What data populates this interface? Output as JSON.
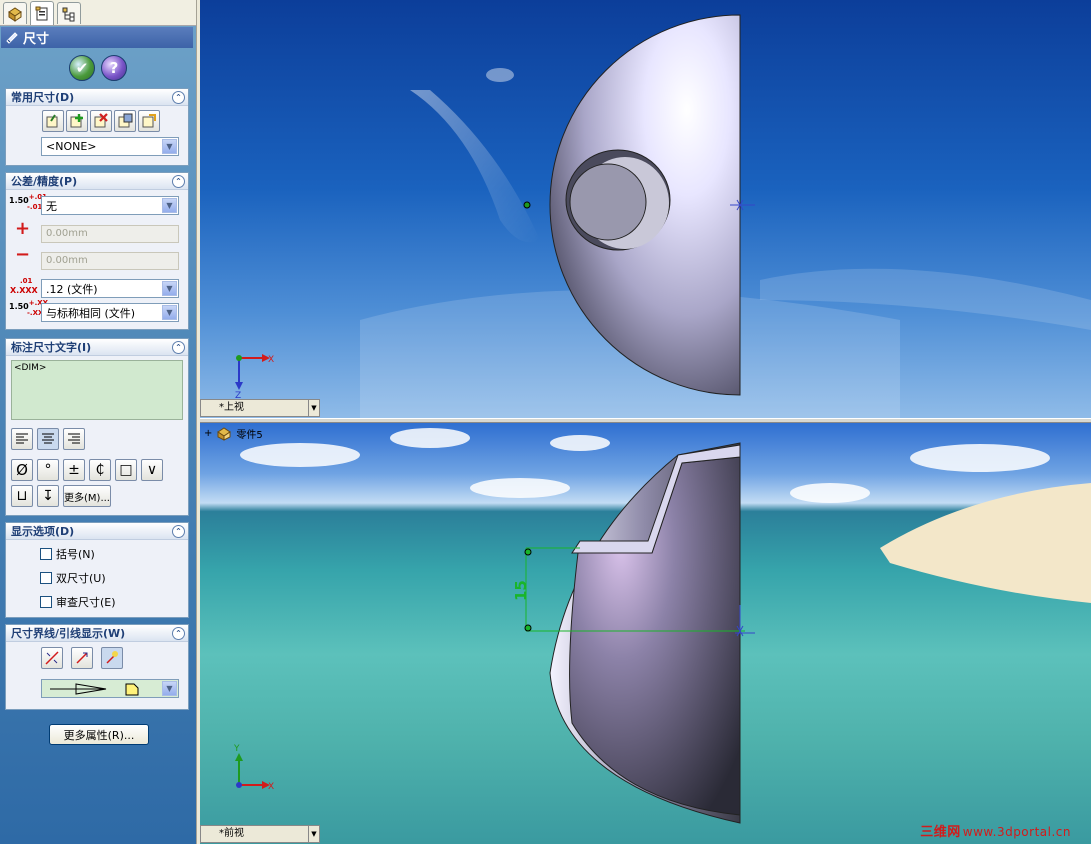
{
  "panel": {
    "tabs": [
      "feature-manager-icon",
      "property-manager-icon",
      "configuration-manager-icon"
    ],
    "title": "尺寸",
    "ok_label": "✔",
    "help_label": "?"
  },
  "groups": {
    "common": {
      "header": "常用尺寸(D)",
      "favorite_value": "<NONE>"
    },
    "tolerance": {
      "header": "公差/精度(P)",
      "type_value": "无",
      "max_placeholder": "0.00mm",
      "min_placeholder": "0.00mm",
      "precision_value": ".12 (文件)",
      "tol_precision_value": "与标称相同 (文件)",
      "icon_tol_main": "1.50",
      "icon_tol_plus": "+.01",
      "icon_tol_minus": "-.01",
      "icon_prec_main": "X.XXX",
      "icon_prec_frac": ".01",
      "icon_tol2_main": "1.50",
      "icon_tol2_plus": "+.XX",
      "icon_tol2_minus": "-.XX"
    },
    "dimtext": {
      "header": "标注尺寸文字(I)",
      "text_value": "<DIM>",
      "symbols": [
        "Ø",
        "°",
        "±",
        "₵",
        "□",
        "∨",
        "⊔",
        "↧"
      ],
      "more_label": "更多(M)..."
    },
    "display": {
      "header": "显示选项(D)",
      "options": [
        "括号(N)",
        "双尺寸(U)",
        "审查尺寸(E)"
      ]
    },
    "leaders": {
      "header": "尺寸界线/引线显示(W)"
    },
    "more_props_label": "更多属性(R)..."
  },
  "viewports": {
    "top": {
      "label": "*上视",
      "axis_x": "X",
      "axis_z": "Z"
    },
    "bottom": {
      "label": "*前视",
      "tree_label": "零件5",
      "tree_expand": "+",
      "axis_x": "X",
      "axis_y": "Y",
      "dim_value": "15"
    }
  },
  "watermark": {
    "cn": "三维网",
    "url": "www.3dportal.cn"
  },
  "colors": {
    "accent": "#3d63a8",
    "dimension": "#19b52a",
    "part": "#c9c7e8"
  }
}
